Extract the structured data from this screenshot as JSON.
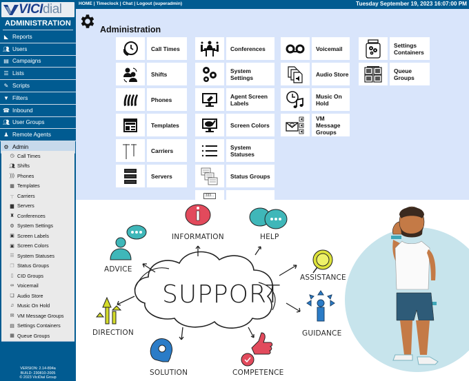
{
  "app": {
    "logo_vici": "VICI",
    "logo_dial": "dial",
    "section_title": "ADMINISTRATION"
  },
  "topbar": {
    "links": [
      {
        "label": "HOME"
      },
      {
        "label": "Timeclock"
      },
      {
        "label": "Chat"
      },
      {
        "label": "Logout (superadmin)"
      }
    ],
    "separator": "|",
    "datetime": "Tuesday September 19, 2023 16:07:00 PM"
  },
  "sidebar": {
    "items": [
      {
        "label": "Reports",
        "icon": "chart-icon"
      },
      {
        "label": "Users",
        "icon": "users-icon"
      },
      {
        "label": "Campaigns",
        "icon": "campaigns-icon"
      },
      {
        "label": "Lists",
        "icon": "lists-icon"
      },
      {
        "label": "Scripts",
        "icon": "scripts-icon"
      },
      {
        "label": "Filters",
        "icon": "filter-icon"
      },
      {
        "label": "Inbound",
        "icon": "inbound-icon"
      },
      {
        "label": "User Groups",
        "icon": "user-groups-icon"
      },
      {
        "label": "Remote Agents",
        "icon": "remote-agents-icon"
      },
      {
        "label": "Admin",
        "icon": "gear-icon",
        "active": true
      }
    ],
    "admin_subitems": [
      {
        "label": "Call Times"
      },
      {
        "label": "Shifts"
      },
      {
        "label": "Phones"
      },
      {
        "label": "Templates"
      },
      {
        "label": "Carriers"
      },
      {
        "label": "Servers"
      },
      {
        "label": "Conferences"
      },
      {
        "label": "System Settings"
      },
      {
        "label": "Screen Labels"
      },
      {
        "label": "Screen Colors"
      },
      {
        "label": "System Statuses"
      },
      {
        "label": "Status Groups"
      },
      {
        "label": "CID Groups"
      },
      {
        "label": "Voicemail"
      },
      {
        "label": "Audio Store"
      },
      {
        "label": "Music On Hold"
      },
      {
        "label": "VM Message Groups"
      },
      {
        "label": "Settings Containers"
      },
      {
        "label": "Queue Groups"
      }
    ],
    "version": "VERSION: 2.14-894a",
    "build": "BUILD: 230810-2005",
    "copyright": "© 2023 ViciDial Group"
  },
  "main": {
    "title": "Administration",
    "columns": [
      [
        {
          "label": "Call Times",
          "icon": "call-times-icon"
        },
        {
          "label": "Shifts",
          "icon": "shifts-icon"
        },
        {
          "label": "Phones",
          "icon": "phones-icon"
        },
        {
          "label": "Templates",
          "icon": "templates-icon"
        },
        {
          "label": "Carriers",
          "icon": "carriers-icon"
        },
        {
          "label": "Servers",
          "icon": "servers-icon"
        }
      ],
      [
        {
          "label": "Conferences",
          "icon": "conferences-icon"
        },
        {
          "label": "System Settings",
          "icon": "system-settings-icon"
        },
        {
          "label": "Agent Screen Labels",
          "icon": "screen-labels-icon"
        },
        {
          "label": "Screen Colors",
          "icon": "screen-colors-icon"
        },
        {
          "label": "System Statuses",
          "icon": "system-statuses-icon"
        },
        {
          "label": "Status Groups",
          "icon": "status-groups-icon"
        },
        {
          "label": "",
          "icon": "cid-groups-icon",
          "icon_text": "333..."
        }
      ],
      [
        {
          "label": "Voicemail",
          "icon": "voicemail-icon"
        },
        {
          "label": "Audio Store",
          "icon": "audio-store-icon"
        },
        {
          "label": "Music On Hold",
          "icon": "music-on-hold-icon"
        },
        {
          "label": "VM Message Groups",
          "icon": "vm-message-groups-icon"
        }
      ],
      [
        {
          "label": "Settings Containers",
          "icon": "settings-containers-icon"
        },
        {
          "label": "Queue Groups",
          "icon": "queue-groups-icon"
        }
      ]
    ]
  },
  "illustration": {
    "center_word": "SUPPORT",
    "labels": {
      "advice": "ADVICE",
      "information": "INFORMATION",
      "help": "HELP",
      "assistance": "ASSISTANCE",
      "direction": "DIRECTION",
      "guidance": "GUIDANCE",
      "solution": "SOLUTION",
      "competence": "COMPETENCE"
    }
  },
  "colors": {
    "brand_blue": "#015b91",
    "panel_bg": "#d9e5fb",
    "active_item_bg": "#c7d9eb",
    "submenu_bg": "#eaeaea"
  }
}
